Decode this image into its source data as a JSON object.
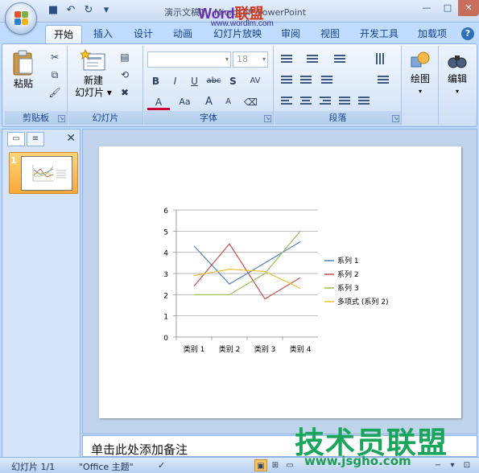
{
  "titlebar": {
    "title": "演示文稿1 - Microsoft PowerPoint",
    "qat": [
      "save-icon",
      "undo-icon",
      "redo-icon",
      "customize-icon"
    ]
  },
  "watermark": {
    "top_brand_a": "Word",
    "top_brand_b": "联盟",
    "top_url": "www.wordlm.com",
    "bottom_brand": "技术员联盟",
    "bottom_url": "www.jsgho.com"
  },
  "tabs": [
    "开始",
    "插入",
    "设计",
    "动画",
    "幻灯片放映",
    "审阅",
    "视图",
    "开发工具",
    "加载项"
  ],
  "ribbon": {
    "clipboard": {
      "label": "剪贴板",
      "paste": "粘贴"
    },
    "slides": {
      "label": "幻灯片",
      "new_slide_line1": "新建",
      "new_slide_line2": "幻灯片 ▾"
    },
    "font": {
      "label": "字体",
      "font_name": "",
      "font_size": "18",
      "bold": "B",
      "italic": "I",
      "underline": "U",
      "strike": "abc",
      "shadow": "S",
      "spacing": "AV",
      "case": "Aa",
      "grow": "A",
      "shrink": "A"
    },
    "paragraph": {
      "label": "段落"
    },
    "drawing": {
      "label": "绘图"
    },
    "editing": {
      "label": "编辑"
    }
  },
  "leftpane": {
    "slide_number": "1"
  },
  "notes": {
    "placeholder": "单击此处添加备注"
  },
  "statusbar": {
    "slide_info": "幻灯片 1/1",
    "theme": "\"Office 主题\""
  },
  "colors": {
    "series1": "#4f81bd",
    "series2": "#c0504d",
    "series3": "#9bbb59",
    "series4": "#e8c232"
  },
  "chart_data": {
    "type": "line",
    "categories": [
      "类别 1",
      "类别 2",
      "类别 3",
      "类别 4"
    ],
    "ylim": [
      0,
      6
    ],
    "yticks": [
      0,
      1,
      2,
      3,
      4,
      5,
      6
    ],
    "grid": true,
    "legend_position": "right",
    "series": [
      {
        "name": "系列 1",
        "values": [
          4.3,
          2.5,
          3.5,
          4.5
        ]
      },
      {
        "name": "系列 2",
        "values": [
          2.4,
          4.4,
          1.8,
          2.8
        ]
      },
      {
        "name": "系列 3",
        "values": [
          2.0,
          2.0,
          3.0,
          5.0
        ]
      },
      {
        "name": "多项式 (系列 2)",
        "values": [
          2.9,
          3.2,
          3.1,
          2.3
        ]
      }
    ]
  }
}
